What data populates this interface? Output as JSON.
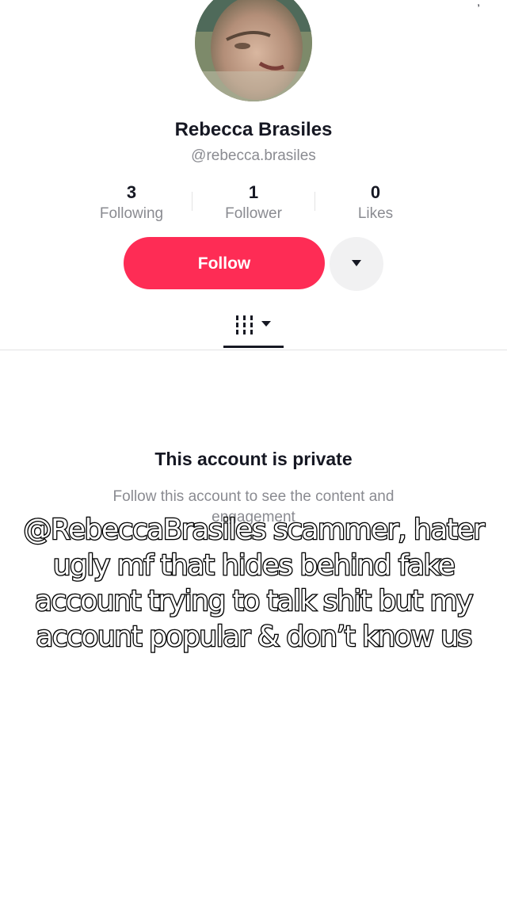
{
  "profile": {
    "display_name": "Rebecca Brasiles",
    "handle": "@rebecca.brasiles",
    "avatar_icon": "profile-photo"
  },
  "stats": [
    {
      "value": "3",
      "label": "Following"
    },
    {
      "value": "1",
      "label": "Follower"
    },
    {
      "value": "0",
      "label": "Likes"
    }
  ],
  "actions": {
    "follow_label": "Follow",
    "more_icon": "caret-down-icon",
    "accent_color": "#fe2c55"
  },
  "tabs": {
    "videos_icon": "video-grid-icon"
  },
  "private_notice": {
    "title": "This account is private",
    "subtitle": "Follow this account to see the content and engagement"
  },
  "overlay_caption": "@RebeccaBrasiles scammer, hater ugly mf that hides behind fake account trying to talk shit but my account popular & don’t know us"
}
